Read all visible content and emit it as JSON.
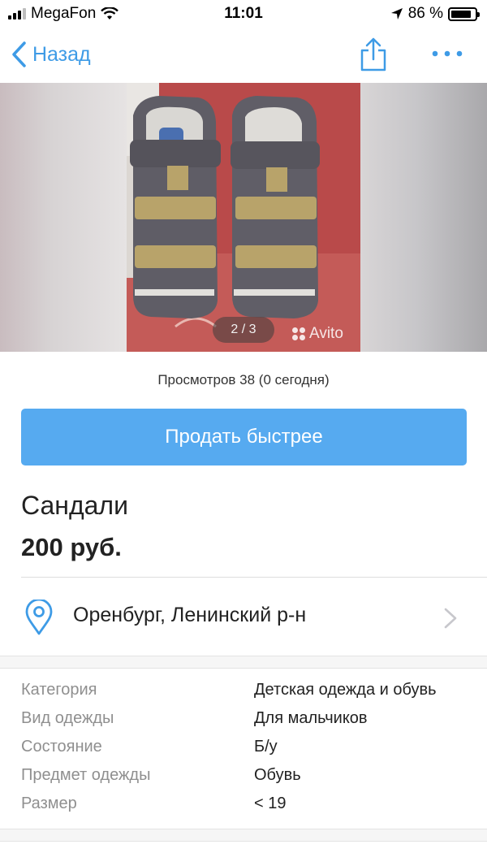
{
  "status_bar": {
    "carrier": "MegaFon",
    "time": "11:01",
    "battery": "86 %",
    "battery_level": 0.86
  },
  "nav": {
    "back_label": "Назад",
    "share_icon": "share-icon",
    "more_icon": "more-icon"
  },
  "gallery": {
    "counter": "2 / 3",
    "watermark": "Avito"
  },
  "views": "Просмотров 38 (0 сегодня)",
  "sell_button": "Продать быстрее",
  "listing": {
    "title": "Сандали",
    "price": "200 руб."
  },
  "location": {
    "text": "Оренбург, Ленинский р-н",
    "icon": "location-pin-icon"
  },
  "params": [
    {
      "label": "Категория",
      "value": "Детская одежда и обувь"
    },
    {
      "label": "Вид одежды",
      "value": "Для мальчиков"
    },
    {
      "label": "Состояние",
      "value": "Б/у"
    },
    {
      "label": "Предмет одежды",
      "value": "Обувь"
    },
    {
      "label": "Размер",
      "value": "< 19"
    }
  ],
  "colors": {
    "accent": "#3e9be6",
    "button": "#56aaf0"
  }
}
